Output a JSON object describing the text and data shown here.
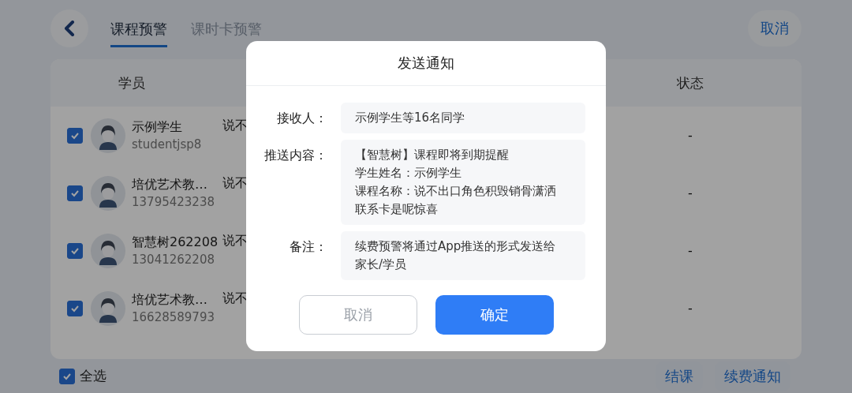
{
  "header": {
    "tabs": [
      {
        "label": "课程预警",
        "selected": true
      },
      {
        "label": "课时卡预警",
        "selected": false
      }
    ],
    "cancel_button": "取消"
  },
  "table": {
    "columns": [
      "学员",
      "状态"
    ],
    "rows": [
      {
        "checked": true,
        "name": "示例学生",
        "account": "studentjsp8",
        "course": "说不",
        "status": "-"
      },
      {
        "checked": true,
        "name": "培优艺术教…",
        "account": "13795423238",
        "course": "说不",
        "status": "-"
      },
      {
        "checked": true,
        "name": "智慧树262208",
        "account": "13041262208",
        "course": "说不",
        "status": "-"
      },
      {
        "checked": true,
        "name": "培优艺术教…",
        "account": "16628589793",
        "course": "说不",
        "status": "-"
      }
    ]
  },
  "footer": {
    "select_all": {
      "label": "全选",
      "checked": true
    },
    "buttons": [
      "结课",
      "续费通知"
    ]
  },
  "dialog": {
    "title": "发送通知",
    "fields": [
      {
        "label": "接收人：",
        "lines": [
          "示例学生等16名同学"
        ]
      },
      {
        "label": "推送内容：",
        "lines": [
          "【智慧树】课程即将到期提醒",
          "学生姓名：示例学生",
          "课程名称：说不出口角色积毁销骨潇洒",
          "联系卡是呢惊喜"
        ]
      },
      {
        "label": "备注：",
        "lines": [
          "续费预警将通过App推送的形式发送给",
          "家长/学员"
        ]
      }
    ],
    "buttons": [
      {
        "label": "取消",
        "kind": "secondary"
      },
      {
        "label": "确定",
        "kind": "primary"
      }
    ]
  }
}
